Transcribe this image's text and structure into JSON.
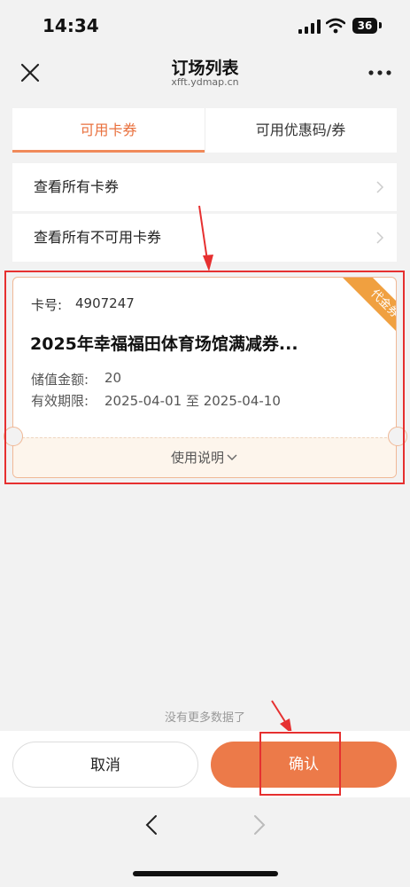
{
  "status_bar": {
    "time": "14:34",
    "battery": "36"
  },
  "nav": {
    "title": "订场列表",
    "subtitle": "xfft.ydmap.cn"
  },
  "tabs": [
    {
      "label": "可用卡券",
      "active": true
    },
    {
      "label": "可用优惠码/券",
      "active": false
    }
  ],
  "rows": [
    {
      "label": "查看所有卡券"
    },
    {
      "label": "查看所有不可用卡券"
    }
  ],
  "coupon": {
    "ribbon": "代金券",
    "card_label": "卡号:",
    "card_number": "4907247",
    "title": "2025年幸福福田体育场馆满减券...",
    "amount_label": "储值金额:",
    "amount_value": "20",
    "validity_label": "有效期限:",
    "validity_value": "2025-04-01 至 2025-04-10",
    "instructions": "使用说明"
  },
  "no_more_text": "没有更多数据了",
  "buttons": {
    "cancel": "取消",
    "confirm": "确认"
  },
  "colors": {
    "accent": "#ec7a49",
    "annotation": "#e63030",
    "ribbon": "#f0a040"
  }
}
